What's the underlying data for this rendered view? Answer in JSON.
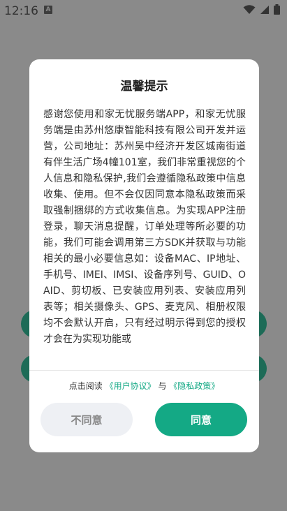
{
  "status_bar": {
    "time": "12:16",
    "app_icon_letter": "A",
    "icons": [
      "wifi-icon",
      "signal-icon",
      "battery-icon"
    ]
  },
  "dialog": {
    "title": "温馨提示",
    "body": "感谢您使用和家无忧服务端APP，和家无忧服务端是由苏州悠康智能科技有限公司开发并运营，公司地址：苏州吴中经济开发区城南街道有伴生活广场4幢101室，我们非常重视您的个人信息和隐私保护,我们会遵循隐私政策中信息收集、使用。但不会仅因同意本隐私政策而采取强制捆绑的方式收集信息。为实现APP注册登录，聊天消息提醒，订单处理等所必要的功能，我们可能会调用第三方SDK并获取与功能相关的最小必要信息如：设备MAC、IP地址、手机号、IMEI、IMSI、设备序列号、GUID、OAID、剪切板、已安装应用列表、安装应用列表等；相关摄像头、GPS、麦克风、相册权限均不会默认开启，只有经过明示得到您的授权才会在为实现功能或",
    "agree_prefix": "点击阅读",
    "user_agreement": "《用户协议》",
    "conjunction": "与",
    "privacy_policy": "《隐私政策》",
    "disagree_label": "不同意",
    "agree_label": "同意"
  },
  "colors": {
    "accent": "#14a985",
    "overlay_background": "#8a8a8a",
    "disagree_background": "#eef0f4"
  }
}
